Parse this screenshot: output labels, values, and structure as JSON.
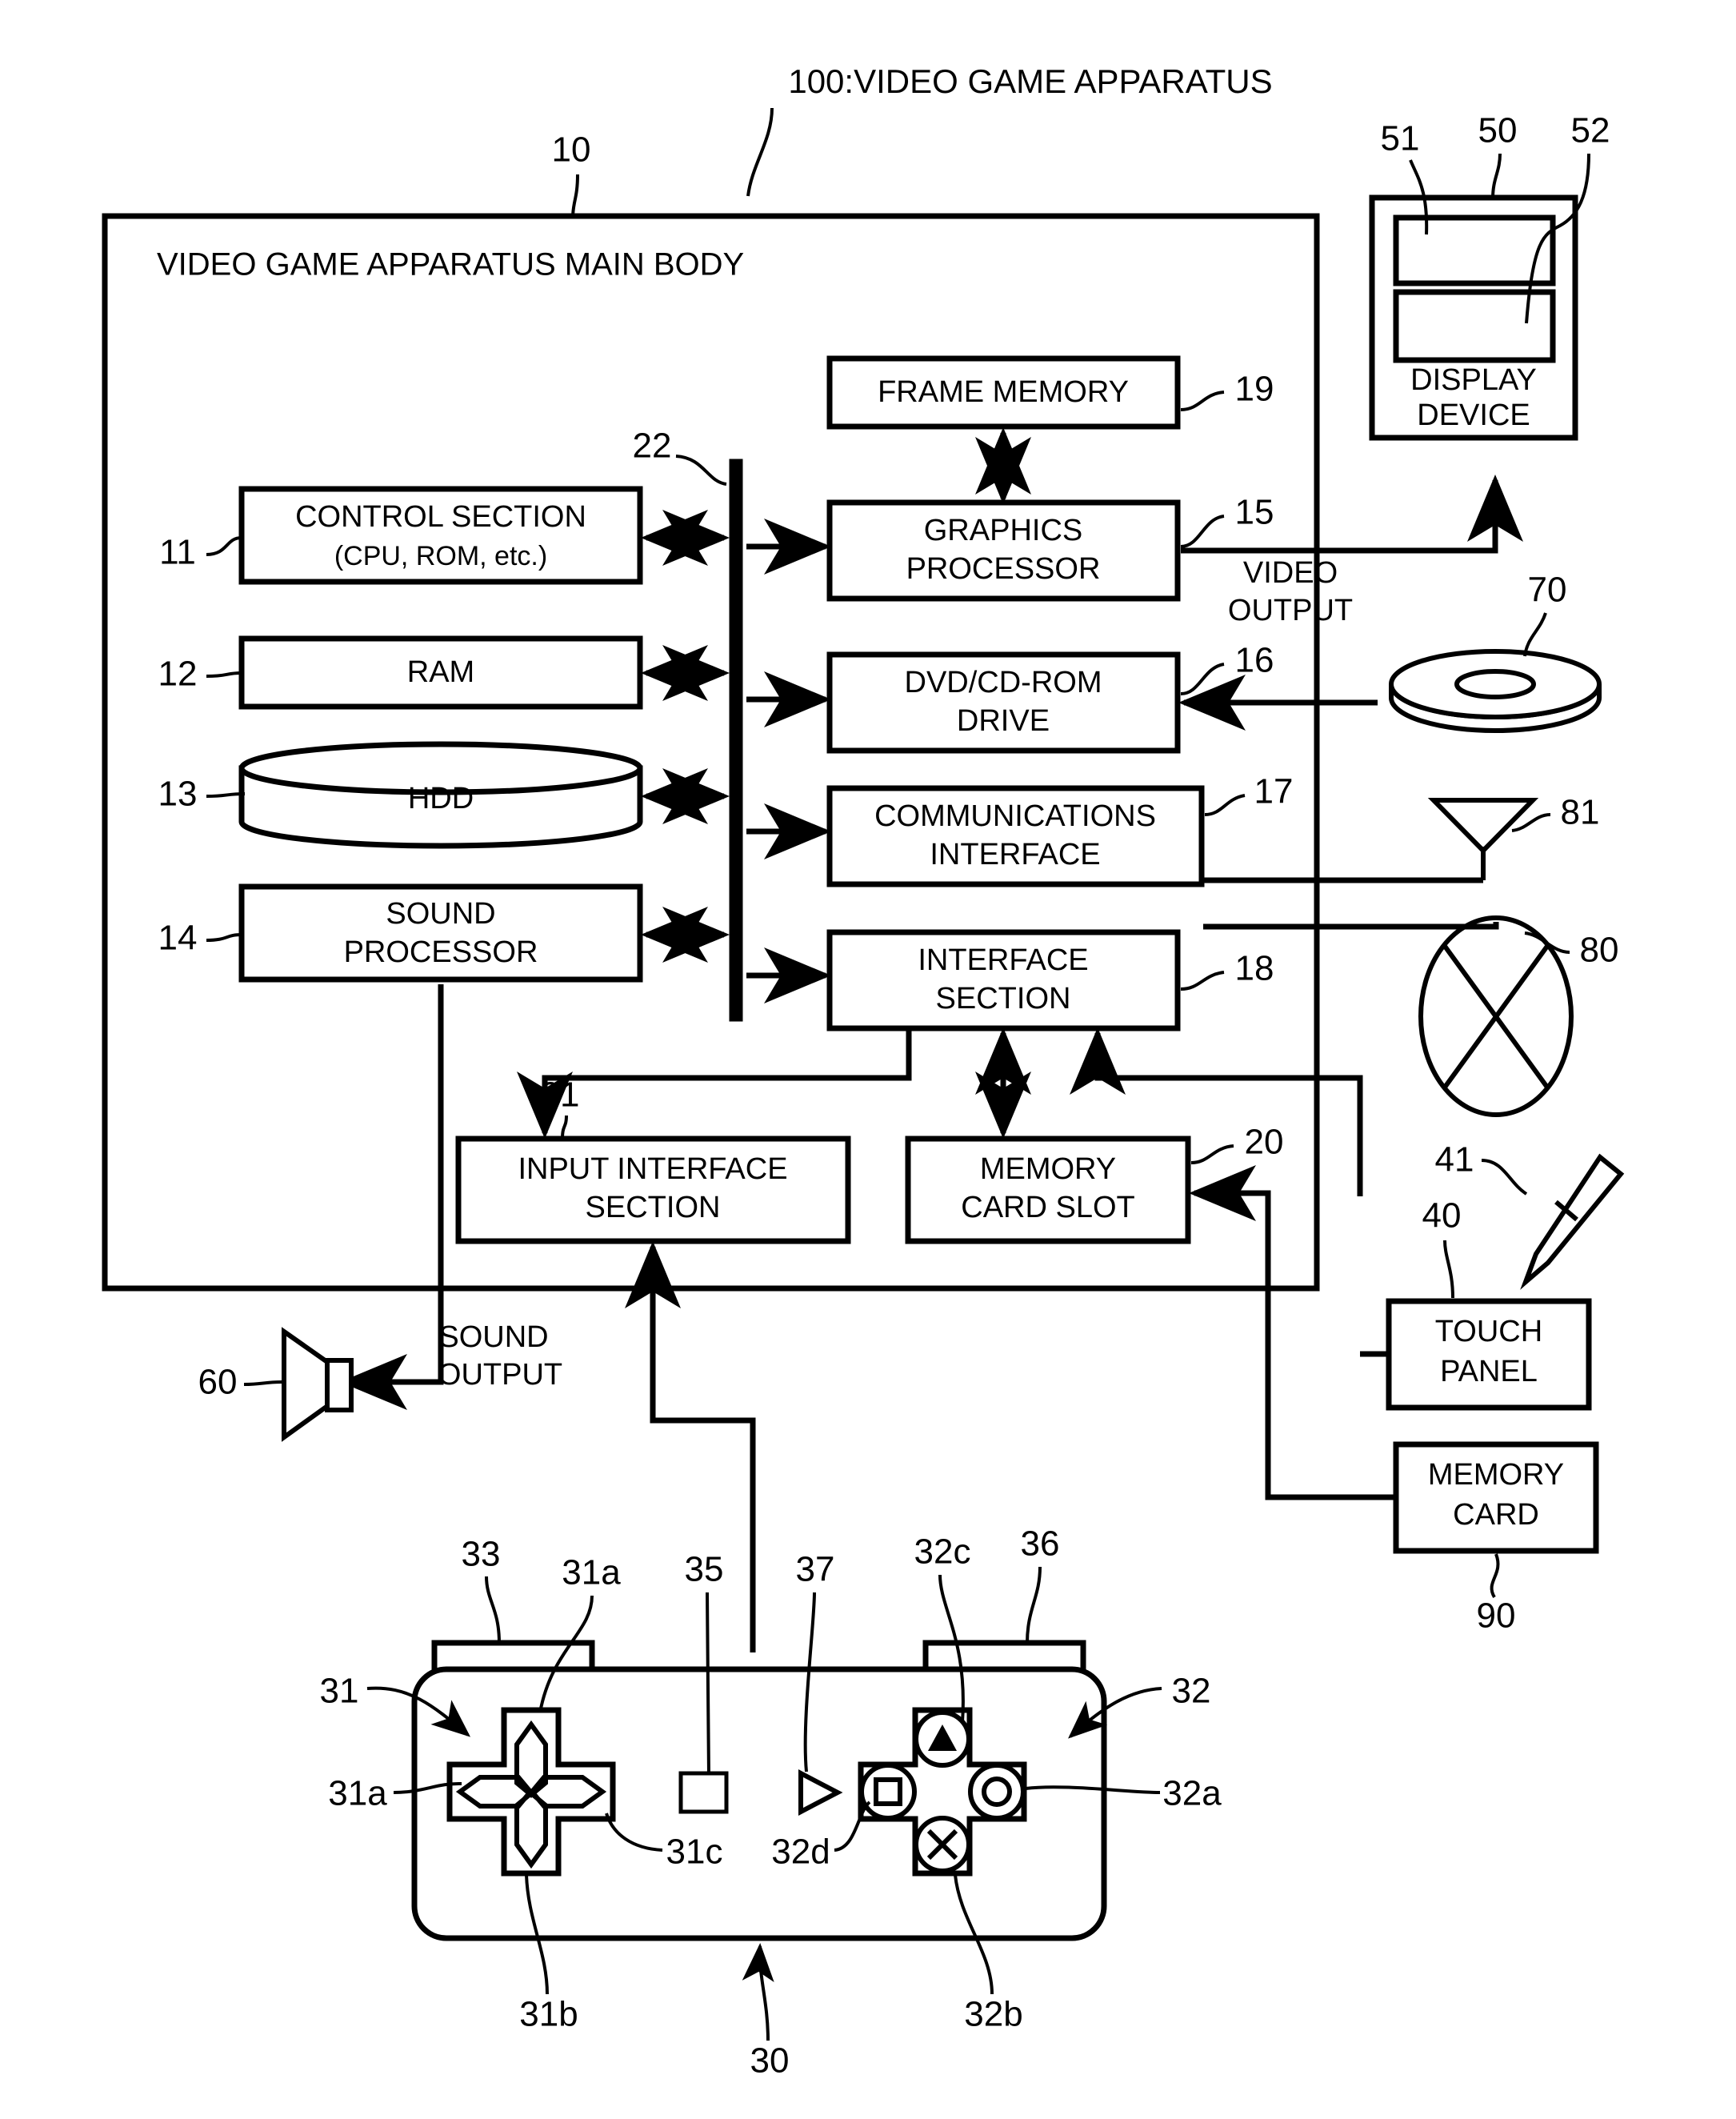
{
  "figure": {
    "title": "100:VIDEO GAME APPARATUS",
    "main_body_label": "VIDEO GAME APPARATUS MAIN BODY",
    "main_body_ref": "10"
  },
  "blocks": {
    "control_section": {
      "line1": "CONTROL SECTION",
      "line2": "(CPU, ROM, etc.)",
      "ref": "11"
    },
    "ram": {
      "line1": "RAM",
      "ref": "12"
    },
    "hdd": {
      "line1": "HDD",
      "ref": "13"
    },
    "sound_processor": {
      "line1": "SOUND",
      "line2": "PROCESSOR",
      "ref": "14"
    },
    "graphics_processor": {
      "line1": "GRAPHICS",
      "line2": "PROCESSOR",
      "ref": "15"
    },
    "dvd_drive": {
      "line1": "DVD/CD-ROM",
      "line2": "DRIVE",
      "ref": "16"
    },
    "communications_interface": {
      "line1": "COMMUNICATIONS",
      "line2": "INTERFACE",
      "ref": "17"
    },
    "interface_section": {
      "line1": "INTERFACE",
      "line2": "SECTION",
      "ref": "18"
    },
    "frame_memory": {
      "line1": "FRAME MEMORY",
      "ref": "19"
    },
    "memory_card_slot": {
      "line1": "MEMORY",
      "line2": "CARD SLOT",
      "ref": "20"
    },
    "input_interface_section": {
      "line1": "INPUT INTERFACE",
      "line2": "SECTION",
      "ref": "21"
    },
    "bus": {
      "ref": "22"
    },
    "display_device": {
      "line1": "DISPLAY",
      "line2": "DEVICE",
      "ref": "50",
      "screen_upper_ref": "51",
      "screen_lower_ref": "52"
    },
    "touch_panel": {
      "line1": "TOUCH",
      "line2": "PANEL",
      "ref": "40",
      "stylus_ref": "41"
    },
    "memory_card": {
      "line1": "MEMORY",
      "line2": "CARD",
      "ref": "90"
    },
    "speaker": {
      "ref": "60"
    },
    "disc": {
      "ref": "70"
    },
    "network": {
      "ref": "80"
    },
    "antenna": {
      "ref": "81"
    }
  },
  "signal_labels": {
    "video_output": {
      "line1": "VIDEO",
      "line2": "OUTPUT"
    },
    "sound_output": {
      "line1": "SOUND",
      "line2": "OUTPUT"
    }
  },
  "controller": {
    "ref": "30",
    "dpad_ref": "31",
    "dpad_button_refs": [
      "31a",
      "31a"
    ],
    "dpad_down_ref": "31b",
    "dpad_right_ref": "31c",
    "action_group_ref": "32",
    "action_circle_ref": "32a",
    "action_cross_ref": "32b",
    "action_triangle_ref": "32c",
    "action_square_ref": "32d",
    "shoulder_left_ref": "33",
    "shoulder_right_ref": "36",
    "select_button_ref": "35",
    "start_button_ref": "37"
  },
  "refs": {
    "n10": "10",
    "n11": "11",
    "n12": "12",
    "n13": "13",
    "n14": "14",
    "n15": "15",
    "n16": "16",
    "n17": "17",
    "n18": "18",
    "n19": "19",
    "n20": "20",
    "n21": "21",
    "n22": "22",
    "n30": "30",
    "n31": "31",
    "n31a_top": "31a",
    "n31a_left": "31a",
    "n31b": "31b",
    "n31c": "31c",
    "n32": "32",
    "n32a": "32a",
    "n32b": "32b",
    "n32c": "32c",
    "n32d": "32d",
    "n33": "33",
    "n35": "35",
    "n36": "36",
    "n37": "37",
    "n40": "40",
    "n41": "41",
    "n50": "50",
    "n51": "51",
    "n52": "52",
    "n60": "60",
    "n70": "70",
    "n80": "80",
    "n81": "81",
    "n90": "90",
    "n100": "100"
  }
}
